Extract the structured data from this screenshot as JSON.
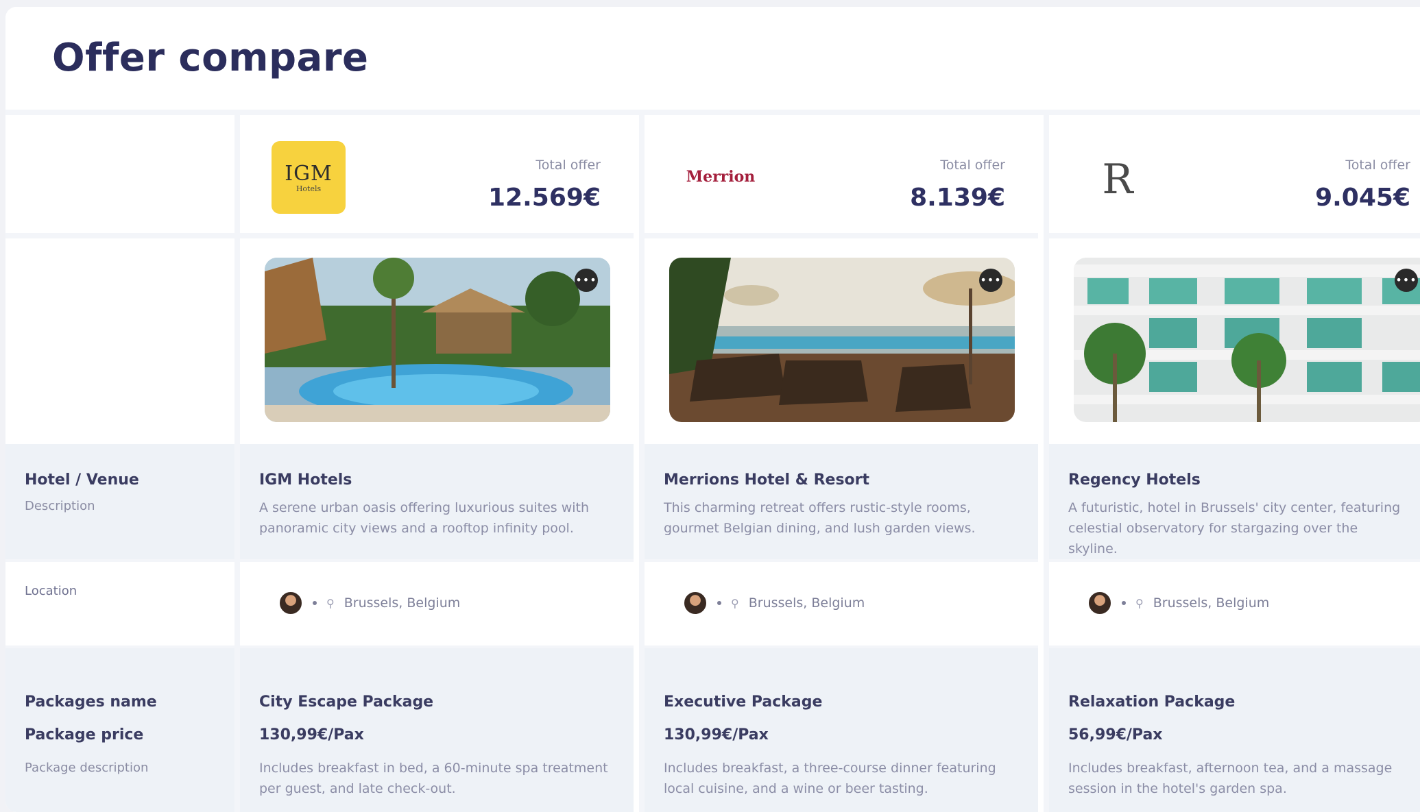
{
  "page": {
    "title": "Offer compare"
  },
  "labels": {
    "hotel_venue": "Hotel / Venue",
    "description": "Description",
    "location": "Location",
    "packages_name": "Packages name",
    "package_price": "Package price",
    "package_description": "Package description"
  },
  "hotels": [
    {
      "logo_text": "IGM",
      "logo_sub": "Hotels",
      "total_label": "Total offer",
      "total_value": "12.569€",
      "photo_icon": "more-icon",
      "name": "IGM Hotels",
      "description": "A serene urban oasis offering luxurious suites with panoramic city views and a rooftop infinity pool.",
      "location": "Brussels, Belgium",
      "package_name": "City Escape Package",
      "package_price": "130,99€/Pax",
      "package_description": "Includes breakfast in bed, a 60-minute spa treatment per guest, and late check-out."
    },
    {
      "logo_text": "Merrion",
      "logo_sub": "",
      "total_label": "Total offer",
      "total_value": "8.139€",
      "photo_icon": "more-icon",
      "name": "Merrions Hotel & Resort",
      "description": "This charming retreat offers rustic-style rooms, gourmet Belgian dining, and lush garden views.",
      "location": "Brussels, Belgium",
      "package_name": "Executive Package",
      "package_price": "130,99€/Pax",
      "package_description": "Includes breakfast, a three-course dinner featuring local cuisine, and a wine or beer tasting."
    },
    {
      "logo_text": "R",
      "logo_sub": "",
      "total_label": "Total offer",
      "total_value": "9.045€",
      "photo_icon": "more-icon",
      "name": "Regency Hotels",
      "description": "A futuristic, hotel in Brussels' city center, featuring celestial observatory for stargazing over the skyline.",
      "location": "Brussels, Belgium",
      "package_name": "Relaxation Package",
      "package_price": "56,99€/Pax",
      "package_description": "Includes breakfast, afternoon tea, and a massage session in the hotel's garden spa."
    }
  ],
  "colors": {
    "title": "#2b2d5c",
    "band": "#eef2f7",
    "igm_logo_bg": "#f7d23e",
    "merrion_logo": "#a41f3c"
  }
}
